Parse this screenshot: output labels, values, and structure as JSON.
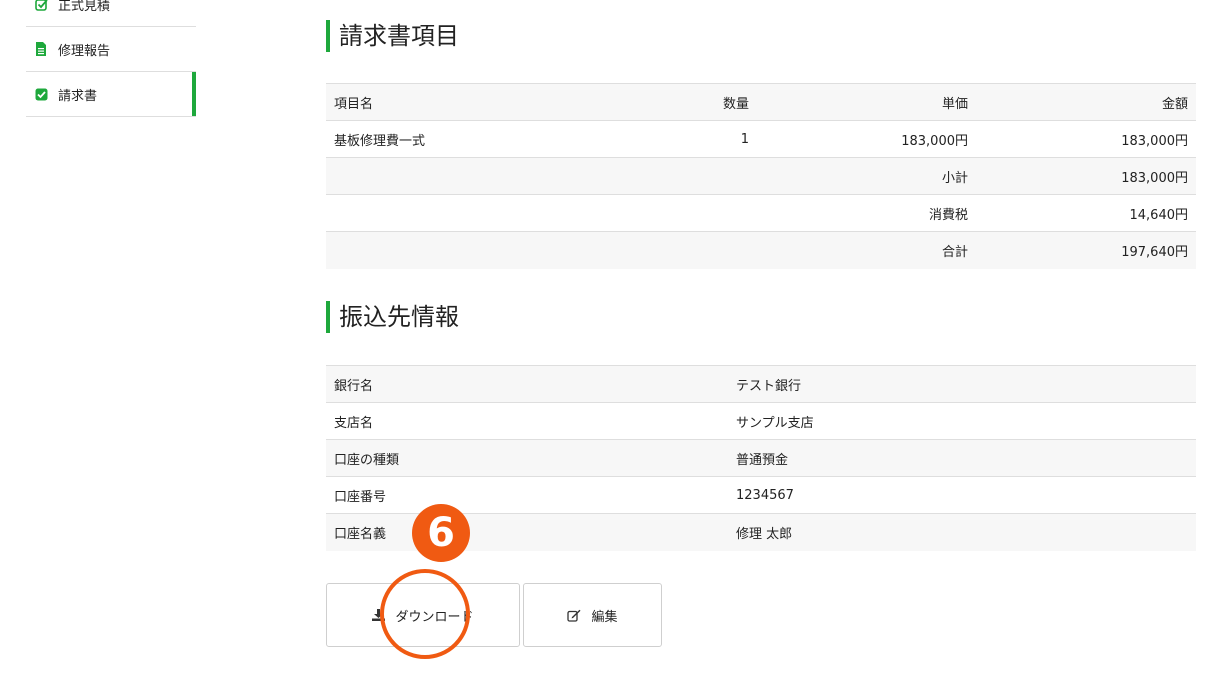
{
  "sidebar": {
    "items": [
      {
        "label": "正式見積",
        "icon": "check-square-icon"
      },
      {
        "label": "修理報告",
        "icon": "file-icon"
      },
      {
        "label": "請求書",
        "icon": "checked-box-icon",
        "active": true
      }
    ]
  },
  "invoice_section": {
    "title": "請求書項目",
    "headers": {
      "name": "項目名",
      "qty": "数量",
      "unit_price": "単価",
      "amount": "金額"
    },
    "row": {
      "name": "基板修理費一式",
      "qty": "1",
      "unit_price": "183,000円",
      "amount": "183,000円"
    },
    "subtotal": {
      "label": "小計",
      "value": "183,000円"
    },
    "tax": {
      "label": "消費税",
      "value": "14,640円"
    },
    "total": {
      "label": "合計",
      "value": "197,640円"
    }
  },
  "bank_section": {
    "title": "振込先情報",
    "rows": [
      {
        "label": "銀行名",
        "value": "テスト銀行"
      },
      {
        "label": "支店名",
        "value": "サンプル支店"
      },
      {
        "label": "口座の種類",
        "value": "普通預金"
      },
      {
        "label": "口座番号",
        "value": "1234567"
      },
      {
        "label": "口座名義",
        "value": "修理 太郎"
      }
    ]
  },
  "actions": {
    "download_label": "ダウンロード",
    "edit_label": "編集"
  },
  "annotation": {
    "step": "6"
  },
  "colors": {
    "accent": "#1ea83c",
    "annotation": "#f05a12"
  }
}
